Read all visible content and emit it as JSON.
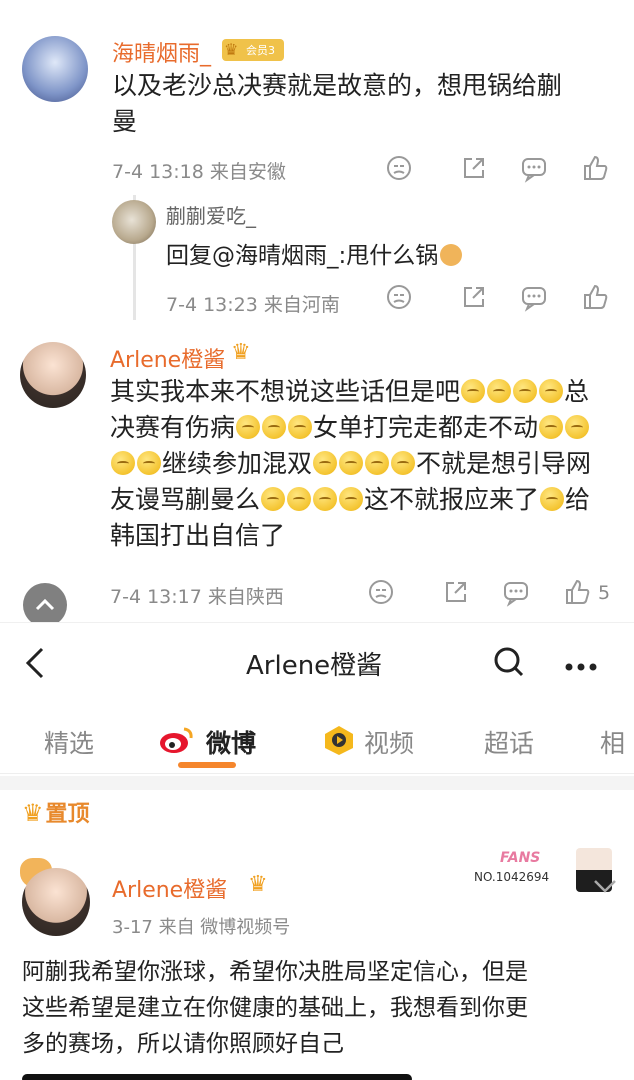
{
  "comment1": {
    "author": "海晴烟雨_",
    "badge": "会员3",
    "text_line1": "以及老沙总决赛就是故意的，想甩锅给蒯",
    "text_line2": "曼",
    "meta": "7-4 13:18  来自安徽"
  },
  "reply1": {
    "author": "蒯蒯爱吃_",
    "text": "回复@海晴烟雨_:甩什么锅",
    "meta": "7-4 13:23  来自河南"
  },
  "comment2": {
    "author": "Arlene橙酱",
    "line1_a": "其实我本来不想说这些话但是吧",
    "line1_b": "总",
    "line2_a": "决赛有伤病",
    "line2_b": "女单打完走都走不动",
    "line3_a": "继续参加混双",
    "line3_b": "不就是想引导网",
    "line4_a": "友谩骂蒯曼么",
    "line4_b": "这不就报应来了",
    "line4_c": "给",
    "line5": "韩国打出自信了",
    "meta": "7-4 13:17  来自陕西",
    "like_count": "5"
  },
  "header": {
    "title": "Arlene橙酱"
  },
  "tabs": {
    "t1": "精选",
    "t2": "微博",
    "t3": "视频",
    "t4": "超话",
    "t5": "相"
  },
  "pinned": {
    "label": "置顶"
  },
  "post": {
    "author": "Arlene橙酱",
    "meta": "3-17  来自 微博视频号",
    "fans_label": "FANS",
    "fans_no": "NO.1042694",
    "line1": "阿蒯我希望你涨球，希望你决胜局坚定信心，但是",
    "line2": "这些希望是建立在你健康的基础上，我想看到你更",
    "line3": "多的赛场，所以请你照顾好自己"
  },
  "colors": {
    "name": "#e86b2c",
    "accent": "#f5862c",
    "meta": "#8a8a8a"
  }
}
